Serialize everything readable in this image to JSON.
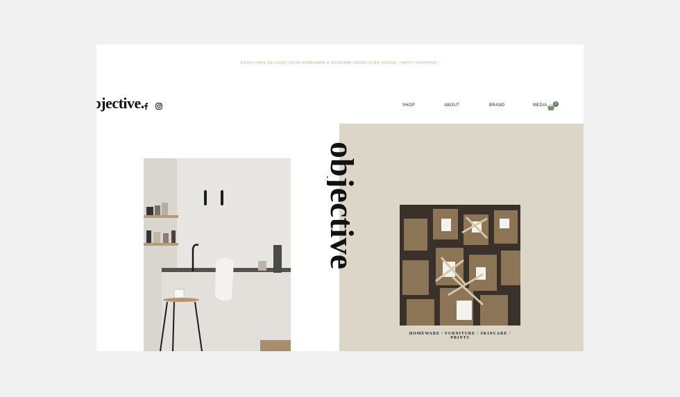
{
  "announcement": "ENJOY FREE DELIVERY UPON HOMEWARE & SKINCARE ORDER OVER HKD500 - HAPPY SHOPPING !",
  "brand": {
    "logo_text": "objective.",
    "vertical_text": "objective."
  },
  "social": {
    "facebook_icon": "facebook-icon",
    "instagram_icon": "instagram-icon"
  },
  "nav": {
    "items": [
      {
        "label": "SHOP"
      },
      {
        "label": "ABOUT"
      },
      {
        "label": "BRAND"
      },
      {
        "label": "MEDIA"
      }
    ],
    "cart_icon": "basket-icon",
    "cart_count": "0"
  },
  "hero": {
    "caption": "HOMEWARE / FURNITURE / SKINCARE / PRINTS"
  },
  "colors": {
    "background": "#f1f1f1",
    "panel": "#dcd6c9",
    "announcement_text": "#c2b594",
    "cart_badge": "#5d7a55"
  }
}
